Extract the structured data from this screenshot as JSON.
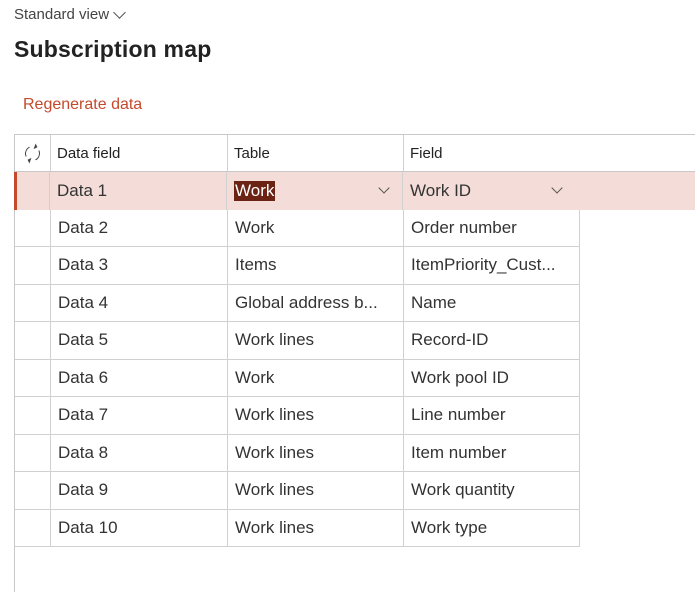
{
  "header": {
    "view_name": "Standard view",
    "title": "Subscription map"
  },
  "actions": {
    "regenerate": "Regenerate data"
  },
  "colors": {
    "accent": "#c54a2c",
    "selected_row": "#f4dcd8",
    "text_highlight": "#6b2414"
  },
  "grid": {
    "columns": [
      "Data field",
      "Table",
      "Field"
    ],
    "refresh_icon": "refresh-icon",
    "rows": [
      {
        "data_field": "Data 1",
        "table": "Work",
        "field": "Work ID"
      },
      {
        "data_field": "Data 2",
        "table": "Work",
        "field": "Order number"
      },
      {
        "data_field": "Data 3",
        "table": "Items",
        "field": "ItemPriority_Cust..."
      },
      {
        "data_field": "Data 4",
        "table": "Global address b...",
        "field": "Name"
      },
      {
        "data_field": "Data 5",
        "table": "Work lines",
        "field": "Record-ID"
      },
      {
        "data_field": "Data 6",
        "table": "Work",
        "field": "Work pool ID"
      },
      {
        "data_field": "Data 7",
        "table": "Work lines",
        "field": "Line number"
      },
      {
        "data_field": "Data 8",
        "table": "Work lines",
        "field": "Item number"
      },
      {
        "data_field": "Data 9",
        "table": "Work lines",
        "field": "Work quantity"
      },
      {
        "data_field": "Data 10",
        "table": "Work lines",
        "field": "Work type"
      }
    ]
  }
}
